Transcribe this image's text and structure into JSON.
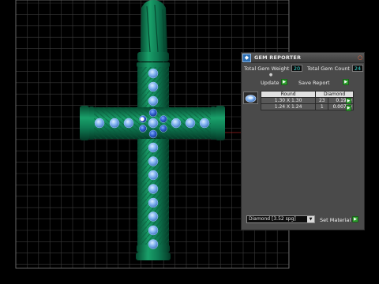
{
  "panel": {
    "title": "GEM REPORTER",
    "icon": "gem-reporter-icon",
    "close_icon": "close-icon",
    "total_weight_label": "Total Gem Weight",
    "total_weight_value": "20",
    "total_count_label": "Total Gem Count",
    "total_count_value": "24",
    "update_label": "Update",
    "save_report_label": "Save Report",
    "table": {
      "headers": [
        "Round",
        "Diamond"
      ],
      "rows": [
        {
          "size": "1.30 X 1.30",
          "count": "23",
          "weight": "0.19tw"
        },
        {
          "size": "1.24 X 1.24",
          "count": "1",
          "weight": "0.007tw"
        }
      ]
    },
    "material_value": "Diamond   [3.52 spg]",
    "set_material_label": "Set Material"
  },
  "colors": {
    "metal": "#0e7a52",
    "metal_dark": "#064a31",
    "gem": "#7fb2f0",
    "grid": "#3a3a3a",
    "go_button": "#2fa02f"
  }
}
